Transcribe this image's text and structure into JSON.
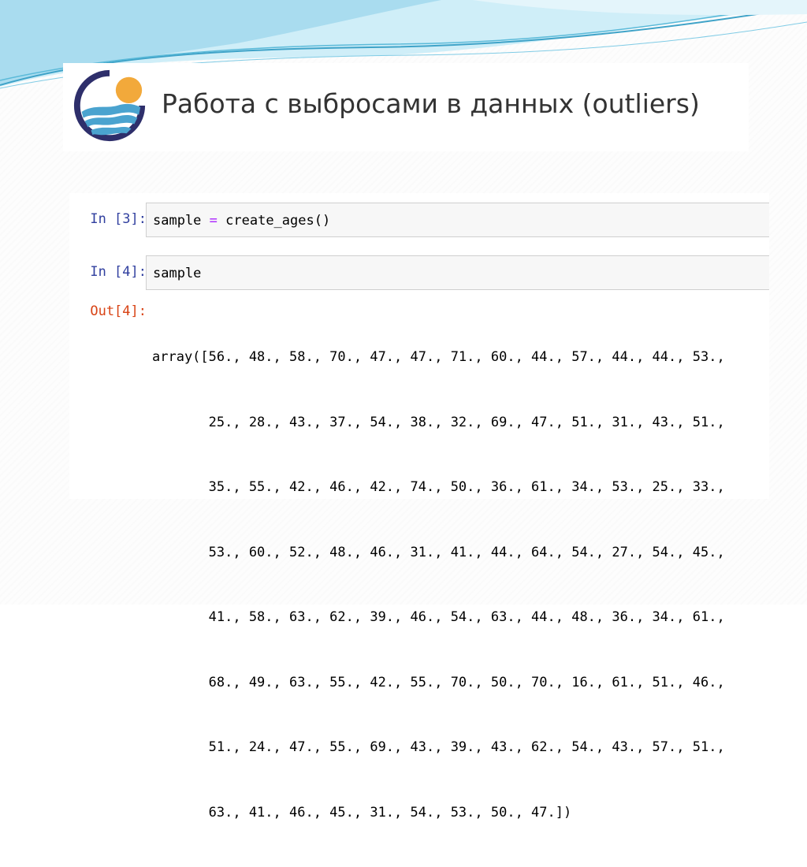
{
  "slide": {
    "title": "Работа с выбросами в данных (outliers)"
  },
  "colors": {
    "logo_ring": "#2e2f6b",
    "logo_sun": "#f2a93b",
    "logo_water": "#4aa3cf",
    "wave_light": "#bfe6f4",
    "wave_dark": "#3fa3c8",
    "prompt_in": "#303f9f",
    "prompt_out": "#d84315"
  },
  "cells": [
    {
      "prompt": "In [3]:",
      "code_before": "sample ",
      "operator": "=",
      "code_after": " create_ages()"
    },
    {
      "prompt": "In [4]:",
      "code": "sample"
    }
  ],
  "output": {
    "prompt": "Out[4]:",
    "lines": [
      "array([56., 48., 58., 70., 47., 47., 71., 60., 44., 57., 44., 44., 53.,",
      "       25., 28., 43., 37., 54., 38., 32., 69., 47., 51., 31., 43., 51.,",
      "       35., 55., 42., 46., 42., 74., 50., 36., 61., 34., 53., 25., 33.,",
      "       53., 60., 52., 48., 46., 31., 41., 44., 64., 54., 27., 54., 45.,",
      "       41., 58., 63., 62., 39., 46., 54., 63., 44., 48., 36., 34., 61.,",
      "       68., 49., 63., 55., 42., 55., 70., 50., 70., 16., 61., 51., 46.,",
      "       51., 24., 47., 55., 69., 43., 39., 43., 62., 54., 43., 57., 51.,",
      "       63., 41., 46., 45., 31., 54., 53., 50., 47.])"
    ]
  }
}
